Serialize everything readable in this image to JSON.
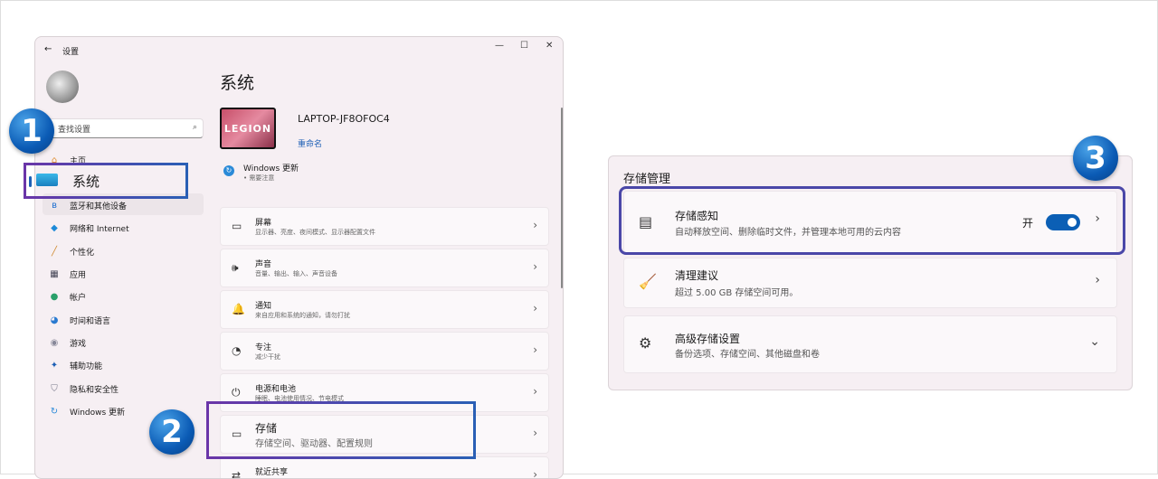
{
  "window": {
    "title": "设置",
    "back": "←",
    "minimize": "—",
    "maximize": "☐",
    "close": "✕"
  },
  "search": {
    "placeholder": "查找设置",
    "icon": "⌕"
  },
  "nav": [
    {
      "label": "主页",
      "icon": "⌂",
      "color": "#e08a2a"
    },
    {
      "label": "系统",
      "icon": "▬",
      "color": "#2aa0d8"
    },
    {
      "label": "蓝牙和其他设备",
      "icon": "ʙ",
      "color": "#1d6fd0"
    },
    {
      "label": "网络和 Internet",
      "icon": "◆",
      "color": "#1d8ad8"
    },
    {
      "label": "个性化",
      "icon": "╱",
      "color": "#d08a30"
    },
    {
      "label": "应用",
      "icon": "▦",
      "color": "#445"
    },
    {
      "label": "帐户",
      "icon": "●",
      "color": "#2aa06a"
    },
    {
      "label": "时间和语言",
      "icon": "◕",
      "color": "#2a7ad0"
    },
    {
      "label": "游戏",
      "icon": "◉",
      "color": "#889"
    },
    {
      "label": "辅助功能",
      "icon": "✦",
      "color": "#1d5fb5"
    },
    {
      "label": "隐私和安全性",
      "icon": "⛉",
      "color": "#778"
    },
    {
      "label": "Windows 更新",
      "icon": "↻",
      "color": "#2a8ad8"
    }
  ],
  "main": {
    "title": "系统",
    "device_logo": "LEGION",
    "device_name": "LAPTOP-JF8OFOC4",
    "rename": "重命名",
    "update": {
      "title": "Windows 更新",
      "status": "• 需要注意"
    },
    "cards": [
      {
        "title": "屏幕",
        "sub": "显示器、亮度、夜间模式、显示器配置文件",
        "icon": "▭"
      },
      {
        "title": "声音",
        "sub": "音量、输出、输入、声音设备",
        "icon": "🕪"
      },
      {
        "title": "通知",
        "sub": "来自应用和系统的通知，请勿打扰",
        "icon": "🔔"
      },
      {
        "title": "专注",
        "sub": "减少干扰",
        "icon": "◔"
      },
      {
        "title": "电源和电池",
        "sub": "睡眠、电池使用情况、节电模式",
        "icon": "⏻"
      },
      {
        "title": "存储",
        "sub": "存储空间、驱动器、配置规则",
        "icon": "▭"
      },
      {
        "title": "就近共享",
        "sub": "",
        "icon": "⇄"
      }
    ]
  },
  "storage_panel": {
    "title": "存储管理",
    "items": [
      {
        "title": "存储感知",
        "sub": "自动释放空间、删除临时文件，并管理本地可用的云内容",
        "icon": "▤",
        "state": "开",
        "toggle_on": true,
        "chevron": "›"
      },
      {
        "title": "清理建议",
        "sub": "超过 5.00 GB 存储空间可用。",
        "icon": "🧹",
        "chevron": "›"
      },
      {
        "title": "高级存储设置",
        "sub": "备份选项、存储空间、其他磁盘和卷",
        "icon": "⚙",
        "chevron": "⌄"
      }
    ]
  },
  "badges": [
    "1",
    "2",
    "3"
  ],
  "chevron": "›"
}
